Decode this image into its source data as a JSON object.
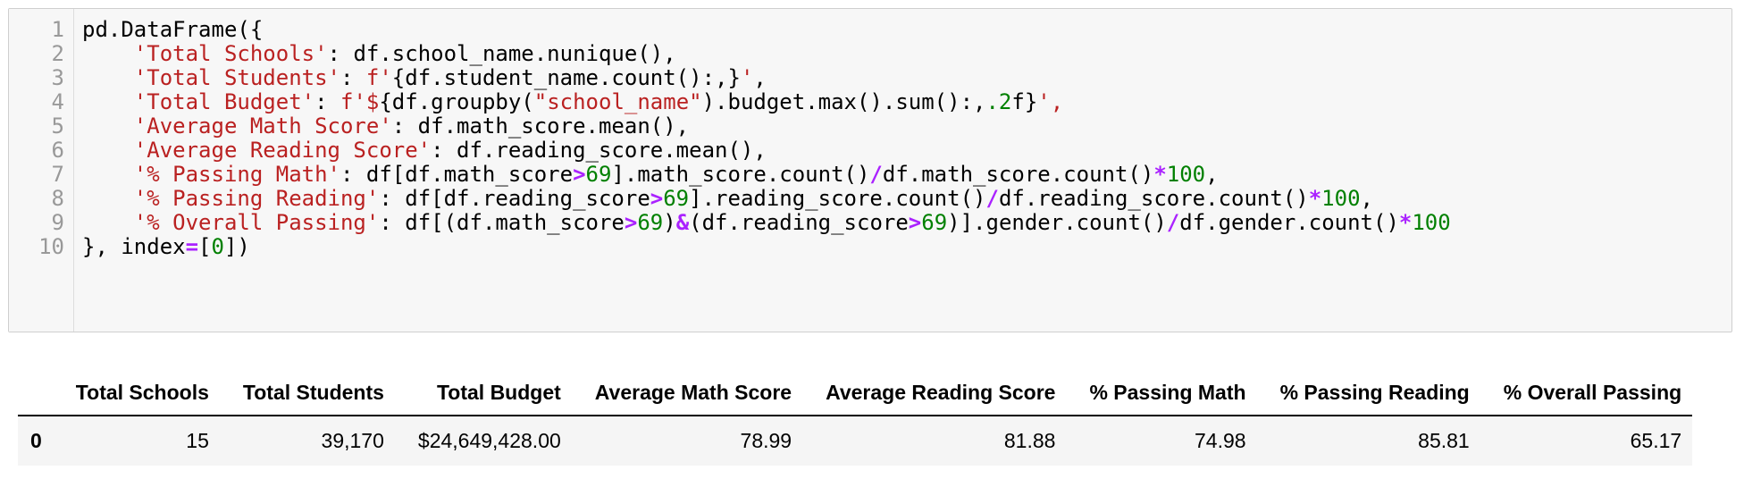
{
  "code_cell": {
    "line_numbers": [
      "1",
      "2",
      "3",
      "4",
      "5",
      "6",
      "7",
      "8",
      "9",
      "10"
    ],
    "lines": [
      [
        {
          "t": "plain",
          "v": "pd.DataFrame({"
        }
      ],
      [
        {
          "t": "plain",
          "v": "    "
        },
        {
          "t": "str",
          "v": "'Total Schools'"
        },
        {
          "t": "plain",
          "v": ": df.school_name.nunique(),"
        }
      ],
      [
        {
          "t": "plain",
          "v": "    "
        },
        {
          "t": "str",
          "v": "'Total Students'"
        },
        {
          "t": "plain",
          "v": ": "
        },
        {
          "t": "str",
          "v": "f'"
        },
        {
          "t": "plain",
          "v": "{df.student_name.count():,}"
        },
        {
          "t": "str",
          "v": "'"
        },
        {
          "t": "plain",
          "v": ","
        }
      ],
      [
        {
          "t": "plain",
          "v": "    "
        },
        {
          "t": "str",
          "v": "'Total Budget'"
        },
        {
          "t": "plain",
          "v": ": "
        },
        {
          "t": "str",
          "v": "f'$"
        },
        {
          "t": "plain",
          "v": "{df.groupby("
        },
        {
          "t": "str",
          "v": "\"school_name\""
        },
        {
          "t": "plain",
          "v": ").budget.max().sum():,"
        },
        {
          "t": "num",
          "v": ".2"
        },
        {
          "t": "plain",
          "v": "f}"
        },
        {
          "t": "str",
          "v": "',"
        }
      ],
      [
        {
          "t": "plain",
          "v": "    "
        },
        {
          "t": "str",
          "v": "'Average Math Score'"
        },
        {
          "t": "plain",
          "v": ": df.math_score.mean(),"
        }
      ],
      [
        {
          "t": "plain",
          "v": "    "
        },
        {
          "t": "str",
          "v": "'Average Reading Score'"
        },
        {
          "t": "plain",
          "v": ": df.reading_score.mean(),"
        }
      ],
      [
        {
          "t": "plain",
          "v": "    "
        },
        {
          "t": "str",
          "v": "'% Passing Math'"
        },
        {
          "t": "plain",
          "v": ": df[df.math_score"
        },
        {
          "t": "op",
          "v": ">"
        },
        {
          "t": "num",
          "v": "69"
        },
        {
          "t": "plain",
          "v": "].math_score.count()"
        },
        {
          "t": "op",
          "v": "/"
        },
        {
          "t": "plain",
          "v": "df.math_score.count()"
        },
        {
          "t": "op",
          "v": "*"
        },
        {
          "t": "num",
          "v": "100"
        },
        {
          "t": "plain",
          "v": ","
        }
      ],
      [
        {
          "t": "plain",
          "v": "    "
        },
        {
          "t": "str",
          "v": "'% Passing Reading'"
        },
        {
          "t": "plain",
          "v": ": df[df.reading_score"
        },
        {
          "t": "op",
          "v": ">"
        },
        {
          "t": "num",
          "v": "69"
        },
        {
          "t": "plain",
          "v": "].reading_score.count()"
        },
        {
          "t": "op",
          "v": "/"
        },
        {
          "t": "plain",
          "v": "df.reading_score.count()"
        },
        {
          "t": "op",
          "v": "*"
        },
        {
          "t": "num",
          "v": "100"
        },
        {
          "t": "plain",
          "v": ","
        }
      ],
      [
        {
          "t": "plain",
          "v": "    "
        },
        {
          "t": "str",
          "v": "'% Overall Passing'"
        },
        {
          "t": "plain",
          "v": ": df[(df.math_score"
        },
        {
          "t": "op",
          "v": ">"
        },
        {
          "t": "num",
          "v": "69"
        },
        {
          "t": "plain",
          "v": ")"
        },
        {
          "t": "op",
          "v": "&"
        },
        {
          "t": "plain",
          "v": "(df.reading_score"
        },
        {
          "t": "op",
          "v": ">"
        },
        {
          "t": "num",
          "v": "69"
        },
        {
          "t": "plain",
          "v": ")].gender.count()"
        },
        {
          "t": "op",
          "v": "/"
        },
        {
          "t": "plain",
          "v": "df.gender.count()"
        },
        {
          "t": "op",
          "v": "*"
        },
        {
          "t": "num",
          "v": "100"
        }
      ],
      [
        {
          "t": "plain",
          "v": "}, index"
        },
        {
          "t": "op",
          "v": "="
        },
        {
          "t": "plain",
          "v": "["
        },
        {
          "t": "num",
          "v": "0"
        },
        {
          "t": "plain",
          "v": "])"
        }
      ]
    ]
  },
  "output_table": {
    "index_header": "",
    "columns": [
      "Total Schools",
      "Total Students",
      "Total Budget",
      "Average Math Score",
      "Average Reading Score",
      "% Passing Math",
      "% Passing Reading",
      "% Overall Passing"
    ],
    "rows": [
      {
        "index": "0",
        "cells": [
          "15",
          "39,170",
          "$24,649,428.00",
          "78.99",
          "81.88",
          "74.98",
          "85.81",
          "65.17"
        ]
      }
    ]
  },
  "colors": {
    "code_background": "#f7f7f7",
    "string": "#ba2121",
    "number": "#008000",
    "operator": "#aa22ff",
    "line_number": "#999999",
    "table_row_background": "#f5f5f5"
  }
}
